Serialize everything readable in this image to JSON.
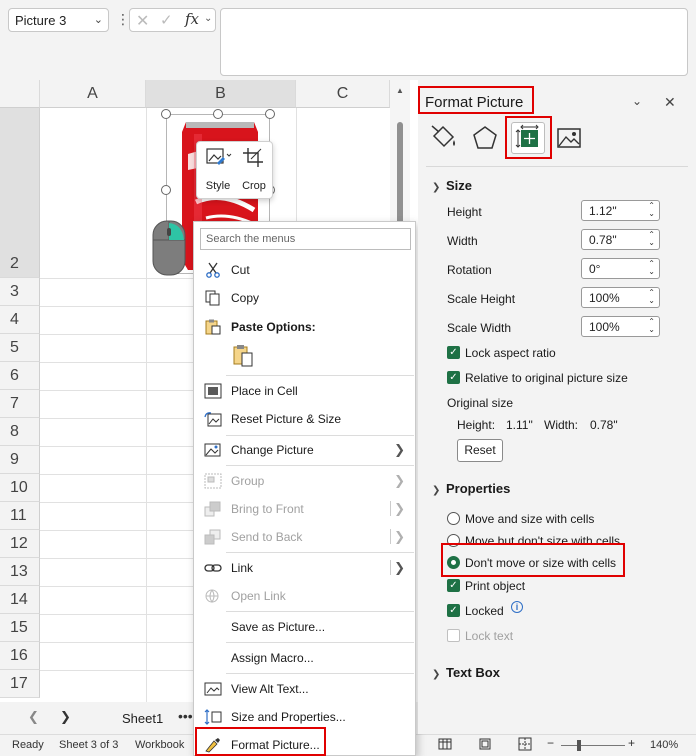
{
  "formula_bar": {
    "name_box": "Picture 3",
    "fx_label": "fx"
  },
  "grid": {
    "columns": [
      "A",
      "B",
      "C"
    ],
    "rows": [
      "2",
      "3",
      "4",
      "5",
      "6",
      "7",
      "8",
      "9",
      "10",
      "11",
      "12",
      "13",
      "14",
      "15",
      "16",
      "17"
    ]
  },
  "mini_toolbar": {
    "style_label": "Style",
    "crop_label": "Crop"
  },
  "context_menu": {
    "search_placeholder": "Search the menus",
    "cut": "Cut",
    "copy": "Copy",
    "paste_options": "Paste Options:",
    "place_in_cell": "Place in Cell",
    "reset_picture_size": "Reset Picture & Size",
    "change_picture": "Change Picture",
    "group": "Group",
    "bring_to_front": "Bring to Front",
    "send_to_back": "Send to Back",
    "link": "Link",
    "open_link": "Open Link",
    "save_as_picture": "Save as Picture...",
    "assign_macro": "Assign Macro...",
    "view_alt_text": "View Alt Text...",
    "size_and_properties": "Size and Properties...",
    "format_picture": "Format Picture..."
  },
  "sheet_tabs": {
    "active_sheet": "Sheet1",
    "more": "•••"
  },
  "status_bar": {
    "mode": "Ready",
    "sheet_info": "Sheet 3 of 3",
    "workbook": "Workbook",
    "zoom": "140%"
  },
  "format_pane": {
    "title": "Format Picture",
    "size_section": "Size",
    "height_label": "Height",
    "height_value": "1.12\"",
    "width_label": "Width",
    "width_value": "0.78\"",
    "rotation_label": "Rotation",
    "rotation_value": "0°",
    "scale_height_label": "Scale Height",
    "scale_height_value": "100%",
    "scale_width_label": "Scale Width",
    "scale_width_value": "100%",
    "lock_aspect_ratio": "Lock aspect ratio",
    "relative_to_original": "Relative to original picture size",
    "original_size_label": "Original size",
    "original_height_label": "Height:",
    "original_height": "1.11\"",
    "original_width_label": "Width:",
    "original_width": "0.78\"",
    "reset_button": "Reset",
    "properties_section": "Properties",
    "move_and_size": "Move and size with cells",
    "move_dont_size": "Move but don't size with cells",
    "dont_move_or_size": "Don't move or size with cells",
    "print_object": "Print object",
    "locked": "Locked",
    "lock_text": "Lock text",
    "text_box_section": "Text Box"
  },
  "colors": {
    "excel_green": "#1e7145",
    "highlight_red": "#e00000",
    "coke_red": "#d8141c"
  }
}
